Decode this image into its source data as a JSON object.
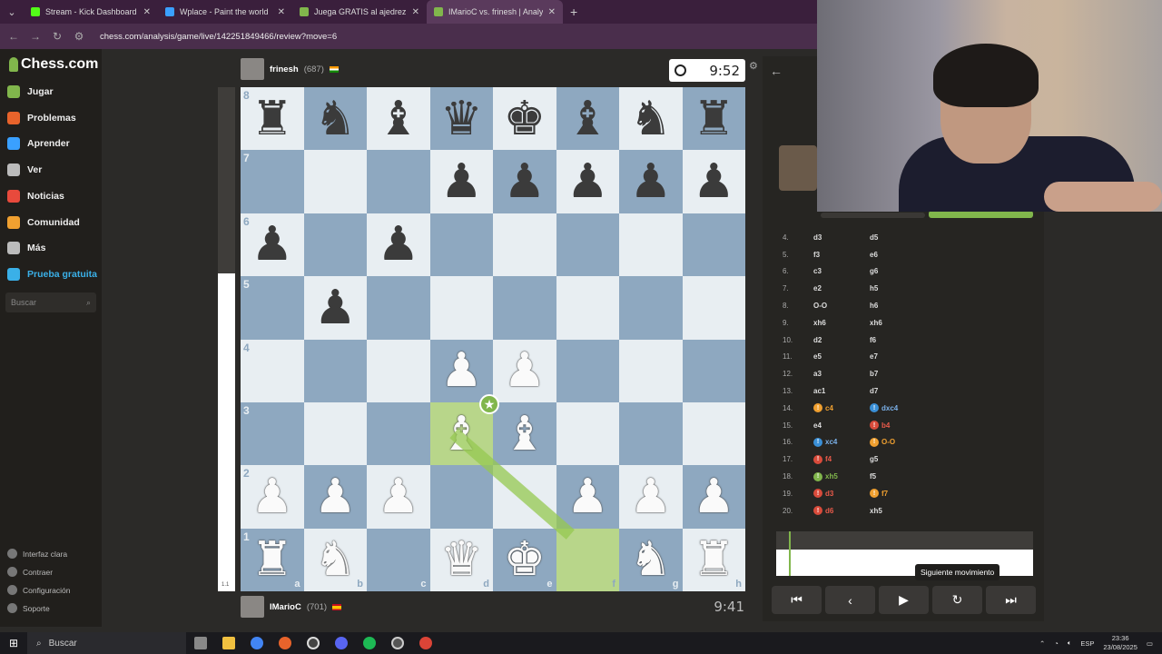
{
  "browser": {
    "tabs": [
      {
        "label": "Stream - Kick Dashboard",
        "color": "#53fc18"
      },
      {
        "label": "Wplace - Paint the world",
        "color": "#3aa0ff"
      },
      {
        "label": "Juega GRATIS al ajedrez online",
        "color": "#81b64c"
      },
      {
        "label": "IMarioC vs. frinesh | Analysis",
        "color": "#81b64c"
      }
    ],
    "new_tab": "+",
    "url": "chess.com/analysis/game/live/142251849466/review?move=6"
  },
  "sidebar": {
    "logo": "Chess.com",
    "items": [
      {
        "label": "Jugar",
        "color": "#81b64c"
      },
      {
        "label": "Problemas",
        "color": "#e8632b"
      },
      {
        "label": "Aprender",
        "color": "#3aa0ff"
      },
      {
        "label": "Ver",
        "color": "#bbbbbb"
      },
      {
        "label": "Noticias",
        "color": "#e84a3c"
      },
      {
        "label": "Comunidad",
        "color": "#f0a030"
      },
      {
        "label": "Más",
        "color": "#bbbbbb"
      },
      {
        "label": "Prueba gratuita",
        "color": "#3ab0e8"
      }
    ],
    "search_placeholder": "Buscar",
    "footer": [
      "Interfaz clara",
      "Contraer",
      "Configuración",
      "Soporte"
    ]
  },
  "game": {
    "top_player": {
      "name": "frinesh",
      "rating": "(687)"
    },
    "bottom_player": {
      "name": "IMarioC",
      "rating": "(701)"
    },
    "top_clock": "9:52",
    "bottom_clock": "9:41",
    "eval_label": "1.1",
    "board": [
      [
        "r",
        "n",
        "b",
        "q",
        "k",
        "b",
        "n",
        "r"
      ],
      [
        "",
        "",
        "",
        "p",
        "p",
        "p",
        "p",
        "p"
      ],
      [
        "p",
        "",
        "p",
        "",
        "",
        "",
        "",
        ""
      ],
      [
        "",
        "p",
        "",
        "",
        "",
        "",
        "",
        ""
      ],
      [
        "",
        "",
        "",
        "P",
        "P",
        "",
        "",
        ""
      ],
      [
        "",
        "",
        "",
        "B",
        "B",
        "",
        "",
        ""
      ],
      [
        "P",
        "P",
        "P",
        "",
        "",
        "P",
        "P",
        "P"
      ],
      [
        "R",
        "N",
        "",
        "Q",
        "K",
        "",
        "N",
        "R"
      ]
    ],
    "ranks": [
      "8",
      "7",
      "6",
      "5",
      "4",
      "3",
      "2",
      "1"
    ],
    "files": [
      "a",
      "b",
      "c",
      "d",
      "e",
      "f",
      "g",
      "h"
    ]
  },
  "moves": [
    {
      "n": "4.",
      "w": "d3",
      "b": "d5"
    },
    {
      "n": "5.",
      "w": "f3",
      "b": "e6"
    },
    {
      "n": "6.",
      "w": "c3",
      "b": "g6"
    },
    {
      "n": "7.",
      "w": "e2",
      "b": "h5"
    },
    {
      "n": "8.",
      "w": "O-O",
      "b": "h6"
    },
    {
      "n": "9.",
      "w": "xh6",
      "b": "xh6"
    },
    {
      "n": "10.",
      "w": "d2",
      "b": "f6"
    },
    {
      "n": "11.",
      "w": "e5",
      "b": "e7"
    },
    {
      "n": "12.",
      "w": "a3",
      "b": "b7"
    },
    {
      "n": "13.",
      "w": "ac1",
      "b": "d7"
    },
    {
      "n": "14.",
      "w": "c4",
      "b": "dxc4"
    },
    {
      "n": "15.",
      "w": "e4",
      "b": "b4"
    },
    {
      "n": "16.",
      "w": "xc4",
      "b": "O-O"
    },
    {
      "n": "17.",
      "w": "f4",
      "b": "g5"
    },
    {
      "n": "18.",
      "w": "xh5",
      "b": "f5"
    },
    {
      "n": "19.",
      "w": "d3",
      "b": "f7"
    },
    {
      "n": "20.",
      "w": "d6",
      "b": "xh5"
    }
  ],
  "tooltip": "Siguiente movimiento",
  "controls": [
    "⏮",
    "‹",
    "▶",
    "↻",
    "⏭"
  ],
  "taskbar": {
    "search": "Buscar",
    "lang": "ESP",
    "time": "23:36",
    "date": "23/08/2025"
  }
}
